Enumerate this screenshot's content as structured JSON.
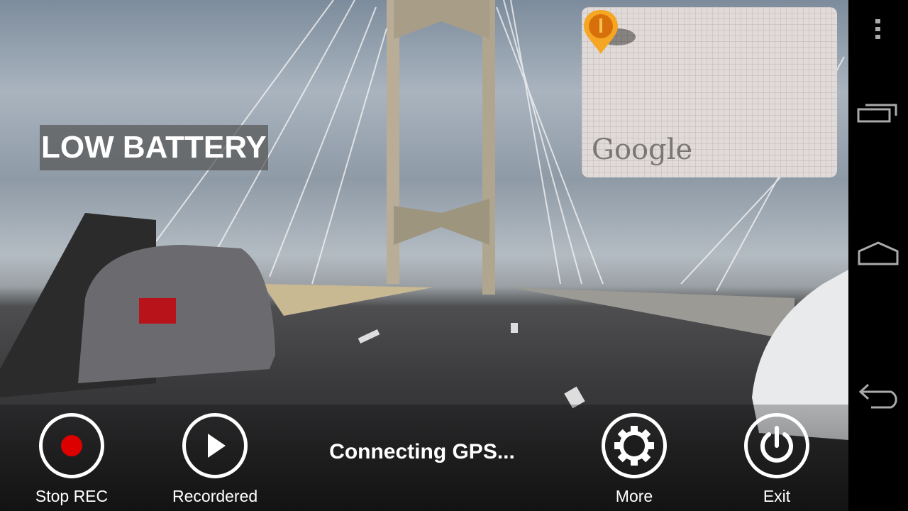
{
  "overlay": {
    "battery_warning": "LOW BATTERY"
  },
  "map": {
    "logo": "Google",
    "marker_icon": "map-pin-icon",
    "marker_color": "#f39a1e"
  },
  "controls": {
    "stop_rec": {
      "label": "Stop REC",
      "icon": "record-icon",
      "icon_color": "#dd0000"
    },
    "recorded": {
      "label": "Recordered",
      "icon": "play-icon"
    },
    "status": "Connecting GPS...",
    "more": {
      "label": "More",
      "icon": "gear-icon"
    },
    "exit": {
      "label": "Exit",
      "icon": "power-icon"
    }
  },
  "system_nav": {
    "items": [
      "menu-icon",
      "recent-apps-icon",
      "home-icon",
      "back-icon"
    ]
  }
}
